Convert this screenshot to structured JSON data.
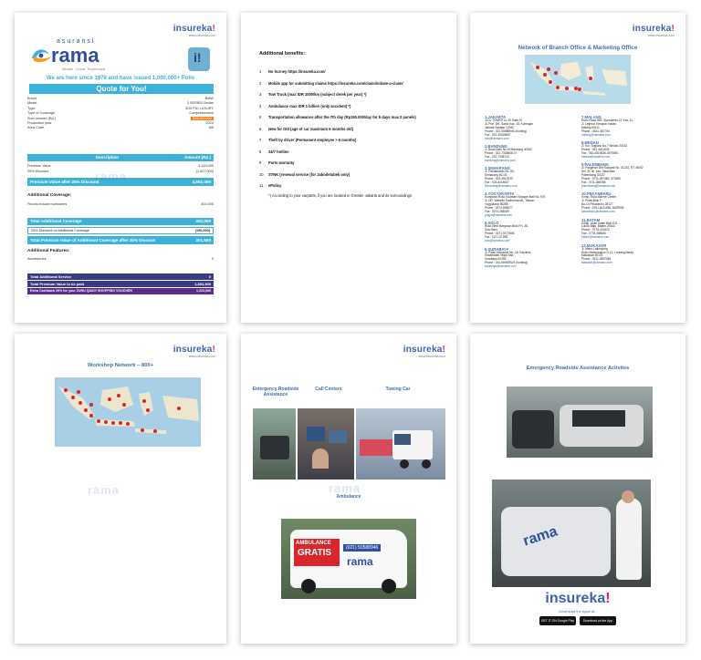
{
  "insureka": {
    "name": "insureka",
    "bang": "!",
    "url": "www.insureka.com"
  },
  "page1": {
    "logo": {
      "small": "asuransi",
      "big": "rama",
      "tagline": "Mudah. Cepat. Terpercaya"
    },
    "since_line": "We are here since 1978 and have issued 1,000,000+ Polis",
    "quote_title": "Quote for You!",
    "fields": [
      {
        "label": "Brand",
        "value": "BMW"
      },
      {
        "label": "Model",
        "value": "3 SERIES Sedan"
      },
      {
        "label": "Type",
        "value": "320I F30 LUXURY"
      },
      {
        "label": "Type of Coverage",
        "value": "Comprehensive"
      },
      {
        "label": "Sum Insured (Rp.)",
        "value": "536,000,000"
      },
      {
        "label": "Production year",
        "value": "2022"
      },
      {
        "label": "Area Code",
        "value": "AB"
      }
    ],
    "desc_header": {
      "left": "Description",
      "right": "Amount (Rp.)"
    },
    "premium_rows": [
      {
        "label": "Premium Value",
        "value": "6,116,000"
      },
      {
        "label": "25%  Discount",
        "value": "(1,527,000)"
      }
    ],
    "premium_after": {
      "label": "Premium Value after 25%  Discount",
      "value": "4,592,000"
    },
    "add_cov_title": "Additional Coverage:",
    "add_cov_row": {
      "label": "Floods include hurricanes",
      "value": "402,000"
    },
    "total_add_cov": {
      "label": "Total Additional Coverage",
      "value": "402,000"
    },
    "discount_add": {
      "label": "25%    Discount on Additional Coverage",
      "value": "(100,000)"
    },
    "total_prem_add": {
      "label": "Total Premium Value of Additional Coverage after 25%  Discoun",
      "value": "301,500"
    },
    "add_feat_title": "Additional Features:",
    "accessories": {
      "label": "Accessories",
      "value": "0"
    },
    "total_add_service": {
      "label": "Total Additional Service",
      "value": "0"
    },
    "total_prem_paid": {
      "label": "Total Premium Value to be paid",
      "value": "4,894,300"
    },
    "cashback": {
      "label": "Extra Cashback  20%  for your ZURU QIANY SHOPPING VOUCHER",
      "value": "1,223,000"
    },
    "watermark": "rama"
  },
  "page2": {
    "title": "Additional benefits:",
    "items": [
      {
        "n": "1",
        "text": "No hurney https://insureka.com/"
      },
      {
        "n": "2",
        "text": "Mobile app for submitting claims https://insureka.com/claim/initiate-a-claim/"
      },
      {
        "n": "3",
        "text": "Tow Truck (max IDR 1000/km (subject derek per year) *)"
      },
      {
        "n": "4",
        "text": "Ambulance max IDR 1 billion (only accident) *)"
      },
      {
        "n": "5",
        "text": "Transportation allowance after the 7th day (Rp150.000/day for 5 days max 3 panels)"
      },
      {
        "n": "6",
        "text": "New for Old (age of car maximum 6 months old)"
      },
      {
        "n": "7",
        "text": "Theft by driver (Permanent employee > 6 months)"
      },
      {
        "n": "8",
        "text": "24/7 hotline"
      },
      {
        "n": "9",
        "text": "Parts warranty"
      },
      {
        "n": "10",
        "text": "STNK (renewal service (for Jabodetabek only)"
      },
      {
        "n": "11",
        "text": "ePolicy"
      }
    ],
    "note": "*) According to your carparts, if you are located in Greater Jakarta and its surroundings"
  },
  "page3": {
    "title": "Network of Branch Office & Marketing Office",
    "branches_left": [
      {
        "name": "1.JAKARTA",
        "lines": [
          "Jl.GL TOWER Lt. 29 Suite 67",
          "Jl. Prof. DR. Satrio Kav. 18, Kuningan",
          "Jakarta Selatan 12940",
          "Phone : 021-50588946 (hunting)",
          "Fax : 021-30028897"
        ],
        "email": "info@ramains.com"
      },
      {
        "name": "2.BANDUNG",
        "lines": [
          "Jl. Buah Batu No.49 Bandung 40262",
          "Phone : 022-7338508-07",
          "Fax : 022-7338742"
        ],
        "email": "bandung@ramains.com"
      },
      {
        "name": "3.SEMARANG",
        "lines": [
          "Jl. Pandanaran No. 50,",
          "Semarang 50133",
          "Phone : 024-3512033",
          "Fax : 024-8418637"
        ],
        "email": "semarang@ramains.com"
      },
      {
        "name": "4.YOGYAKARTA",
        "lines": [
          "Kompleks Ruko Kuantan Gejayan Mall No. R/3",
          "Jl. DR. Wahidin Sudirohusodo, Tilanan",
          "Yogyakarta 55285",
          "Phone : 0274-558077",
          "Fax : 0274-268089"
        ],
        "email": "yogya@ramains.com"
      },
      {
        "name": "5.SOLO",
        "lines": [
          "Ruko New Manyulan Blok FH. 38,",
          "Solo Baru",
          "Phone : 0271-5727806",
          "Fax : 0271-57288"
        ],
        "email": "solo@ramains.com"
      },
      {
        "name": "6.SURABAYA",
        "lines": [
          "Jl. Polan Menarwe No. 18, Kayubisi,",
          "Kecamatan Tegal Sari,",
          "Surabaya 60265",
          "Phone : 031-5594552/4 (hunting)"
        ],
        "email": "surabaya@ramains.com"
      }
    ],
    "branches_right": [
      {
        "name": "7.MALANG",
        "lines": [
          "Ruko Plaza WR. Supratman C2 Kav. 11,",
          "Jl. Letjend. Ketapon Hakim,",
          "Malang 65111",
          "Phone : 0341-361794"
        ],
        "email": "malang@ramains.com"
      },
      {
        "name": "8.MEDAN",
        "lines": [
          "Jl. Kol. Sugiono No.7 Medan 20152",
          "Phone : 061-4511936",
          "Fax : 061-4519836-4575050"
        ],
        "email": "medan@ramains.com"
      },
      {
        "name": "9.PALEMBANG",
        "lines": [
          "Jl. Pangeran Dirt Sudayat No. 3122A, RT. 8/002",
          "Kel. 30 Ilir, Kec. Ilalai Baru",
          "Palembang 30137",
          "Phone : 0711-357380, 373486",
          "Fax : 0711-360085"
        ],
        "email": "palembang@ramains.com"
      },
      {
        "name": "10.PEKANBARU",
        "lines": [
          "Komp. Ruko Banne Center,",
          "Jl. Pinas Blok F",
          "No.14 Pekanbaru 28127",
          "Phone : 0761-8411066, 8429905"
        ],
        "email": "pekanbaru@ramains.com"
      },
      {
        "name": "11.BATAM",
        "lines": [
          "Komp. Alum Indah Blok K11",
          "Lubuk Baja, Batam 29444",
          "Phone : 0778-421620",
          "Fax : 0778-458656"
        ],
        "email": "batam@ramains.com"
      },
      {
        "name": "12.MAKASAR",
        "lines": [
          "Jl. Metro Latimojong",
          "Ruko Mahmaulpus G 12, Lantang Baraji,",
          "Makassar 90131",
          "Phone : 0411-3692348"
        ],
        "email": "makasar@ramains.com"
      }
    ]
  },
  "page4": {
    "title": "Workshop Network – 800+",
    "watermark": "rama"
  },
  "page5": {
    "labels": [
      "Emergency Roadside Assistance",
      "Call Centers",
      "Towing Car"
    ],
    "ambulance": "Ambulance",
    "ambulance_text": "AMBULANCE",
    "gratis": "GRATIS",
    "phone": "(021) 50588946"
  },
  "page6": {
    "title": "Emergency Roadside Assistance Activites",
    "download": "Download the Apps at :",
    "google_play": "GET IT ON Google Play",
    "app_store": "Download on the App Store"
  },
  "colors": {
    "cyan": "#3db1d8",
    "navy": "#3a3b86",
    "purple": "#5b2c8c",
    "blue": "#3d6fb4",
    "pink": "#e6206b"
  }
}
